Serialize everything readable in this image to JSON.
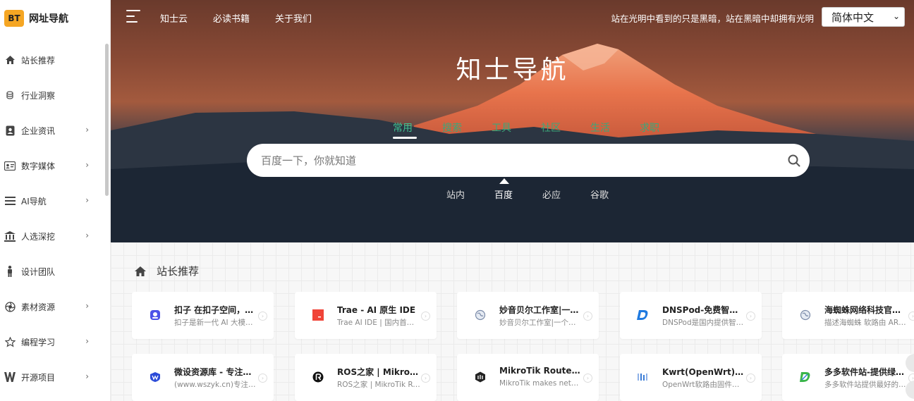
{
  "sidebar": {
    "logo_badge": "BT",
    "logo_text": "网址导航",
    "items": [
      {
        "label": "站长推荐",
        "icon": "home-icon",
        "has_arrow": false
      },
      {
        "label": "行业洞察",
        "icon": "coin-icon",
        "has_arrow": false
      },
      {
        "label": "企业资讯",
        "icon": "id-badge-icon",
        "has_arrow": true
      },
      {
        "label": "数字媒体",
        "icon": "id-card-icon",
        "has_arrow": true
      },
      {
        "label": "AI导航",
        "icon": "bars-icon",
        "has_arrow": true
      },
      {
        "label": "人选深挖",
        "icon": "bank-icon",
        "has_arrow": true
      },
      {
        "label": "设计团队",
        "icon": "person-icon",
        "has_arrow": false
      },
      {
        "label": "素材资源",
        "icon": "aperture-icon",
        "has_arrow": true
      },
      {
        "label": "编程学习",
        "icon": "star-icon",
        "has_arrow": true
      },
      {
        "label": "开源项目",
        "icon": "w-logo-icon",
        "has_arrow": true
      }
    ]
  },
  "topnav": {
    "links": [
      "知士云",
      "必读书籍",
      "关于我们"
    ],
    "slogan": "站在光明中看到的只是黑暗，站在黑暗中却拥有光明",
    "language": "简体中文"
  },
  "hero": {
    "title": "知士导航",
    "tabs": [
      "常用",
      "搜索",
      "工具",
      "社区",
      "生活",
      "求职"
    ],
    "active_tab": "常用",
    "search_placeholder": "百度一下，你就知道",
    "engines": [
      "站内",
      "百度",
      "必应",
      "谷歌"
    ],
    "active_engine": "百度"
  },
  "section": {
    "title": "站长推荐",
    "cards": [
      {
        "title": "扣子 在扣子空间，…",
        "desc": "扣子是新一代 AI 大模型…",
        "icon": "coze-icon",
        "color": "#4d53e8"
      },
      {
        "title": "Trae - AI 原生 IDE",
        "desc": "Trae AI IDE | 国内首款A…",
        "icon": "trae-icon",
        "color": "#f04438"
      },
      {
        "title": "妙音贝尔工作室|一…",
        "desc": "妙音贝尔工作室|一个面…",
        "icon": "globe-icon",
        "color": "#7a8aa8"
      },
      {
        "title": "DNSPod-免费智能…",
        "desc": "DNSPod是国内提供智…",
        "icon": "dnspod-icon",
        "color": "#1f7ae0"
      },
      {
        "title": "海蜘蛛网络科技官方…",
        "desc": "描述海蜘蛛 软路由 ARP…",
        "icon": "globe-icon",
        "color": "#7a8aa8"
      },
      {
        "title": "微设资源库 - 专注海…",
        "desc": "(www.wszyk.cn)专注于…",
        "icon": "wszyk-icon",
        "color": "#2b4bd8"
      },
      {
        "title": "ROS之家 | MikroTi…",
        "desc": "ROS之家 | MikroTik Ro…",
        "icon": "ros-icon",
        "color": "#111111"
      },
      {
        "title": "MikroTik Routers …",
        "desc": "MikroTik makes netwo…",
        "icon": "mikrotik-icon",
        "color": "#222222"
      },
      {
        "title": "Kwrt(OpenWrt)软…",
        "desc": "OpenWrt软路由固件下…",
        "icon": "kwrt-icon",
        "color": "#3a7bd5"
      },
      {
        "title": "多多软件站-提供绿…",
        "desc": "多多软件站提供最好的…",
        "icon": "duoduo-icon",
        "color": "#3bb54a"
      }
    ]
  }
}
